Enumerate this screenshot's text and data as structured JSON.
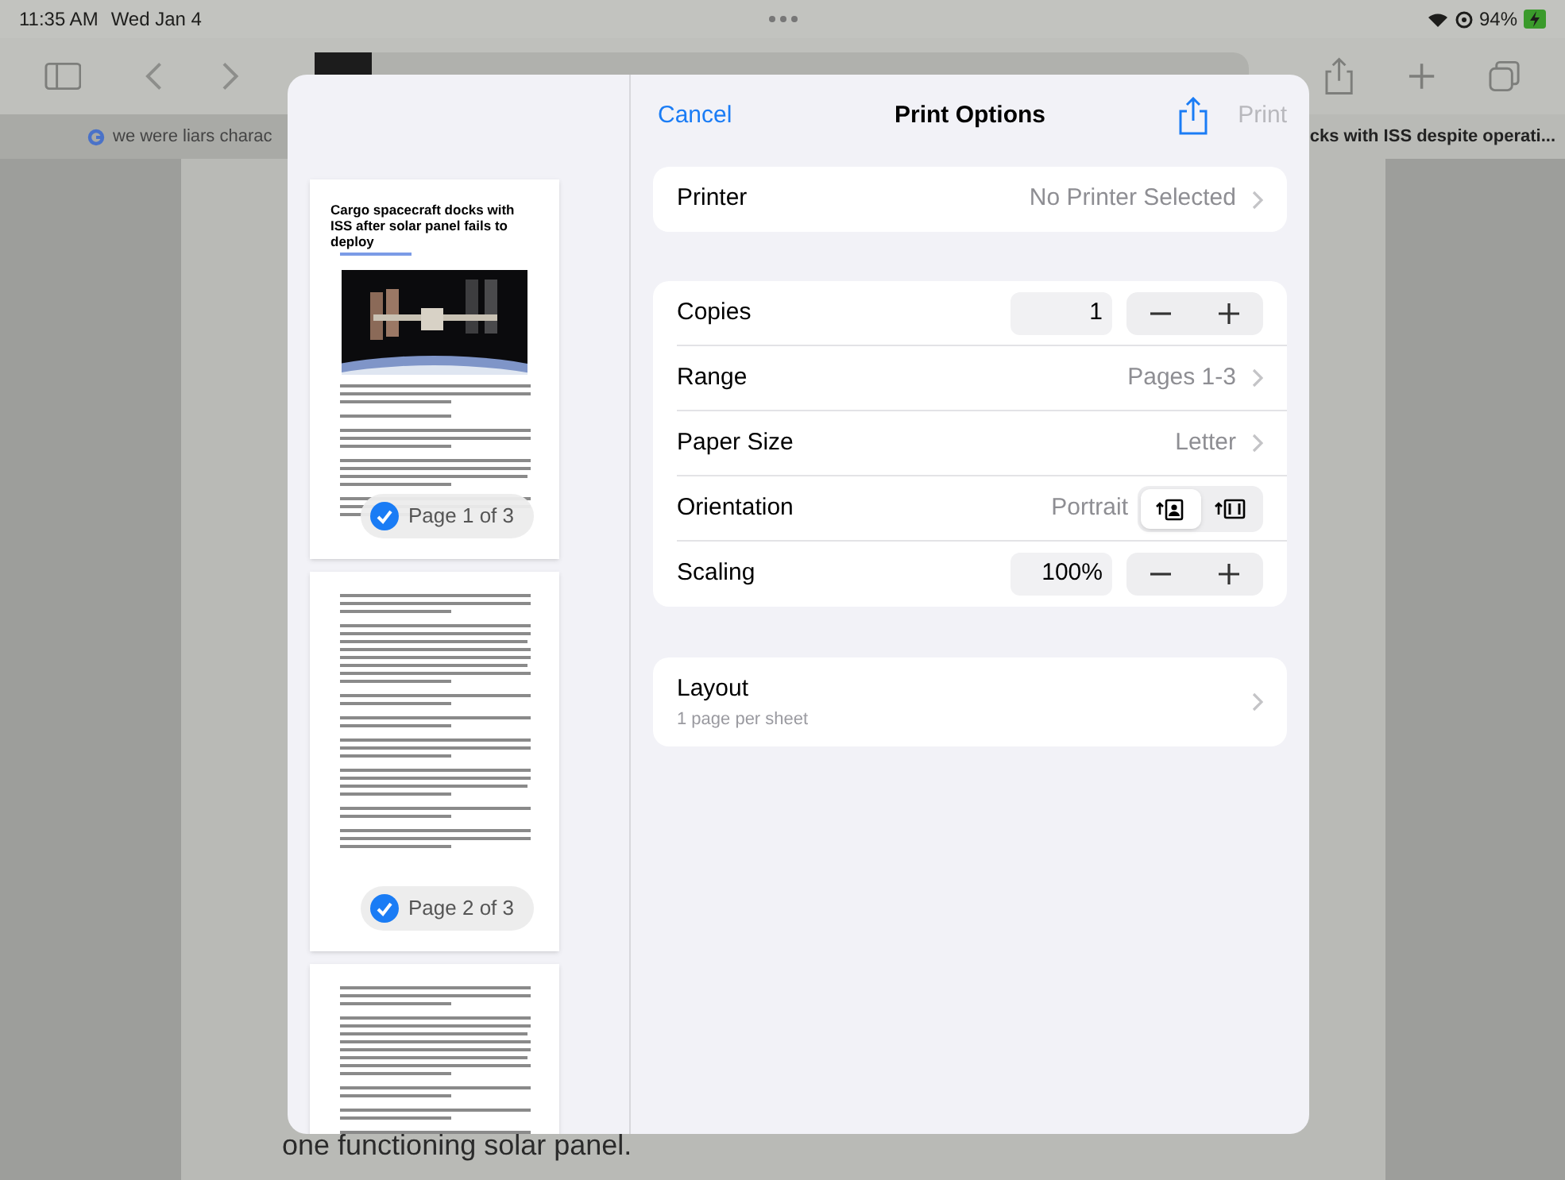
{
  "status_bar": {
    "time": "11:35 AM",
    "date": "Wed Jan 4",
    "battery": "94%"
  },
  "browser": {
    "tabs": [
      {
        "title": "we were liars charac",
        "selected": false
      },
      {
        "title": "cks with ISS despite operati...",
        "selected": true
      }
    ],
    "page_text": "one functioning solar panel."
  },
  "print_dialog": {
    "cancel": "Cancel",
    "title": "Print Options",
    "print": {
      "label": "Print",
      "disabled": true
    },
    "previews": [
      {
        "kind": "title_page",
        "headline": "Cargo spacecraft docks with ISS after solar panel fails to deploy",
        "page_label": "Page 1 of 3",
        "selected": true
      },
      {
        "kind": "text_page",
        "page_label": "Page 2 of 3",
        "selected": true
      },
      {
        "kind": "text_page"
      }
    ],
    "printer": {
      "label": "Printer",
      "value": "No Printer Selected"
    },
    "options": [
      {
        "kind": "stepper",
        "label": "Copies",
        "value": "1"
      },
      {
        "kind": "link",
        "label": "Range",
        "value": "Pages 1-3"
      },
      {
        "kind": "link",
        "label": "Paper Size",
        "value": "Letter"
      },
      {
        "kind": "orientation",
        "label": "Orientation",
        "value": "Portrait",
        "choices": [
          {
            "selected": true
          },
          {
            "selected": false
          }
        ]
      },
      {
        "kind": "stepper",
        "label": "Scaling",
        "value": "100%"
      }
    ],
    "layout": {
      "label": "Layout",
      "subtitle": "1 page per sheet"
    }
  }
}
